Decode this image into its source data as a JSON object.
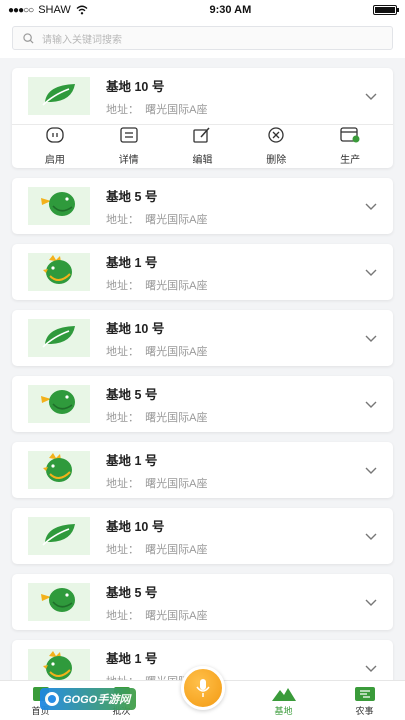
{
  "status_bar": {
    "carrier": "SHAW",
    "time": "9:30 AM"
  },
  "search": {
    "placeholder": "请输入关键词搜索"
  },
  "expanded_actions": [
    {
      "label": "启用",
      "icon": "power-icon"
    },
    {
      "label": "详情",
      "icon": "details-icon"
    },
    {
      "label": "编辑",
      "icon": "edit-icon"
    },
    {
      "label": "删除",
      "icon": "delete-icon"
    },
    {
      "label": "生产",
      "icon": "production-icon"
    }
  ],
  "bases": [
    {
      "title": "基地 10 号",
      "address": "地址：  曙光国际A座",
      "icon": "leaf-icon"
    },
    {
      "title": "基地 5 号",
      "address": "地址：  曙光国际A座",
      "icon": "fish-icon"
    },
    {
      "title": "基地 1 号",
      "address": "地址：  曙光国际A座",
      "icon": "chicken-icon"
    },
    {
      "title": "基地 10 号",
      "address": "地址：  曙光国际A座",
      "icon": "leaf-icon"
    },
    {
      "title": "基地 5 号",
      "address": "地址：  曙光国际A座",
      "icon": "fish-icon"
    },
    {
      "title": "基地 1 号",
      "address": "地址：  曙光国际A座",
      "icon": "chicken-icon"
    },
    {
      "title": "基地 10 号",
      "address": "地址：  曙光国际A座",
      "icon": "leaf-icon"
    },
    {
      "title": "基地 5 号",
      "address": "地址：  曙光国际A座",
      "icon": "fish-icon"
    },
    {
      "title": "基地 1 号",
      "address": "地址：  曙光国际A座",
      "icon": "chicken-icon"
    }
  ],
  "tabbar": {
    "tabs": [
      {
        "label": "首页",
        "icon": "home-icon"
      },
      {
        "label": "批次",
        "icon": "batch-icon"
      },
      {
        "label": "基地",
        "icon": "base-mountain-icon",
        "active": true
      },
      {
        "label": "农事",
        "icon": "farm-work-icon"
      }
    ],
    "center_icon": "microphone-icon"
  },
  "watermark": {
    "text": "GOGO手游网"
  },
  "colors": {
    "accent_green": "#3a9b3a",
    "leaf_green": "#2f9a3c",
    "mic_orange": "#f39a12"
  }
}
